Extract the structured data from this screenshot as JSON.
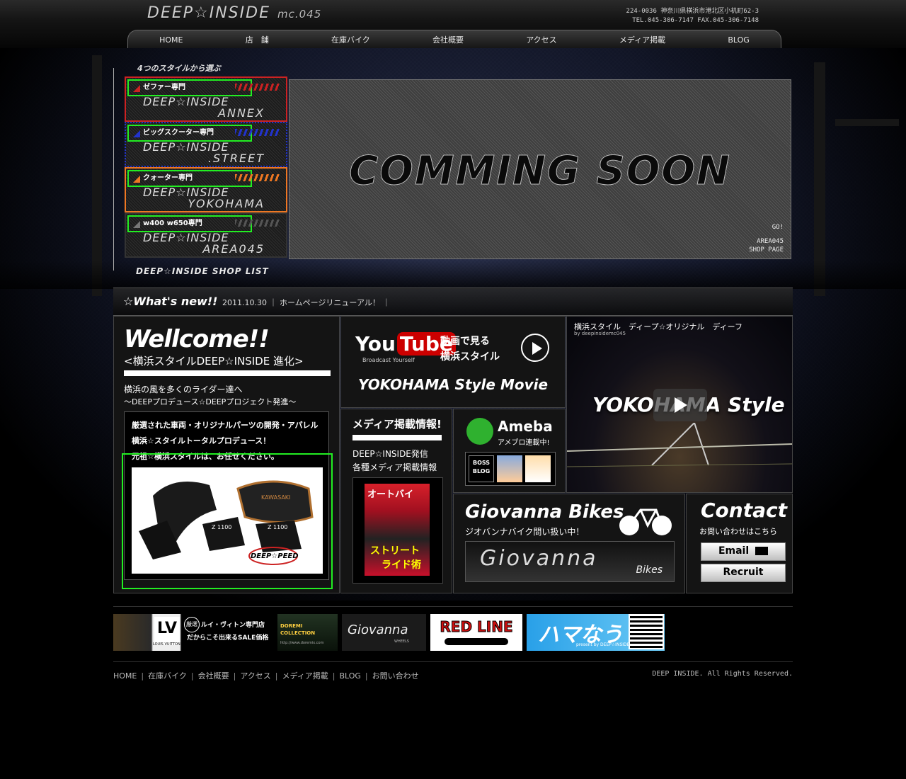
{
  "header": {
    "logo": "DEEP☆INSIDE",
    "logo_sub": "mc.045",
    "address_line1": "224-0036 神奈川県横浜市港北区小机町62-3",
    "address_line2": "TEL.045-306-7147 FAX.045-306-7148"
  },
  "nav": [
    "HOME",
    "店　舗",
    "在庫バイク",
    "会社概要",
    "アクセス",
    "メディア掲載",
    "BLOG"
  ],
  "shops": {
    "frame_title": "4つのスタイルから選ぶ",
    "footer": "DEEP☆INSIDE SHOP LIST",
    "items": [
      {
        "tag": "ゼファー専門",
        "line1": "DEEP☆INSIDE",
        "line2": "ANNEX",
        "color": "#cc2222"
      },
      {
        "tag": "ビッグスクーター専門",
        "line1": "DEEP☆INSIDE",
        "line2": ".STREET",
        "color": "#2233cc"
      },
      {
        "tag": "クォーター専門",
        "line1": "DEEP☆INSIDE",
        "line2": "YOKOHAMA",
        "color": "#ee7722"
      },
      {
        "tag": "w400 w650専門",
        "line1": "DEEP☆INSIDE",
        "line2": "AREA045",
        "color": "#555555"
      }
    ]
  },
  "coming": {
    "text": "COMMING SOON",
    "go": "GO!",
    "shop": "AREA045",
    "page": "SHOP PAGE"
  },
  "news": {
    "title": "☆What's new!!",
    "text": "2011.10.30 ｜ ホームページリニューアル！ ｜"
  },
  "welcome": {
    "title": "Wellcome!!",
    "subtitle": "<横浜スタイルDEEP☆INSIDE 進化>",
    "line1": "横浜の風を多くのライダー達へ",
    "line2": "〜DEEPプロデュース☆DEEPプロジェクト発進〜",
    "box_line1": "厳選された車両・オリジナルパーツの開発・アパレル",
    "box_line2": "横浜☆スタイルトータルプロデュース！",
    "box_line3": "元祖☆横浜スタイルは、お任せください。",
    "photo_label1": "Z 1100",
    "photo_label2": "Z 1100",
    "photo_brand": "KAWASAKI",
    "photo_logo": "DEEP☆PEED"
  },
  "youtube": {
    "logo_you": "You",
    "logo_tube": "Tube",
    "tagline": "Broadcast Yourself",
    "line1": "動画で見る",
    "line2": "横浜スタイル",
    "caption": "YOKOHAMA Style Movie"
  },
  "video": {
    "title": "横浜スタイル　ディープ☆オリジナル　ディーフ",
    "by": "by deepinsidemc045",
    "overlay": "YOKOHAMA Style"
  },
  "media": {
    "title": "メディア掲載情報!",
    "line1": "DEEP☆INSIDE発信",
    "line2": "各種メディア掲載情報",
    "mag_title": "オートバイ",
    "mag_text": "ストリート",
    "mag_text2": "ライド術"
  },
  "ameba": {
    "name": "Ameba",
    "sub": "アメブロ連載中!",
    "boss": "BOSS BLOG",
    "boss_sub": "Ameba"
  },
  "giovanna": {
    "title": "Giovanna Bikes",
    "sub": "ジオバンナバイク問い扱い中！",
    "logo": "Giovanna",
    "logo_sub": "Bikes"
  },
  "contact": {
    "title": "Contact",
    "sub": "お問い合わせはこちら",
    "email": "Email",
    "recruit": "Recruit"
  },
  "banners": {
    "lv_badge": "厳選",
    "lv_line1": "ルイ・ヴィトン専門店",
    "lv_line2": "だからこそ出来るSALE価格",
    "lv_logo_sub": "LOUIS VUITTON",
    "doremi": "DOREMI COLLECTION",
    "doremi_url": "http://www.doremix.com",
    "giovanna": "Giovanna",
    "giovanna_sub": "WHEELS",
    "redline": "RED LINE",
    "hama": "ハマなう",
    "hama_sub": "present by DEEP☆INSIDE"
  },
  "footer": {
    "links": [
      "HOME",
      "在庫バイク",
      "会社概要",
      "アクセス",
      "メディア掲載",
      "BLOG",
      "お問い合わせ"
    ],
    "copyright": "DEEP INSIDE. All Rights Reserved."
  },
  "colors": {
    "accent_green": "#22ee22",
    "youtube_red": "#cc0000",
    "ameba_green": "#2fb12f"
  }
}
